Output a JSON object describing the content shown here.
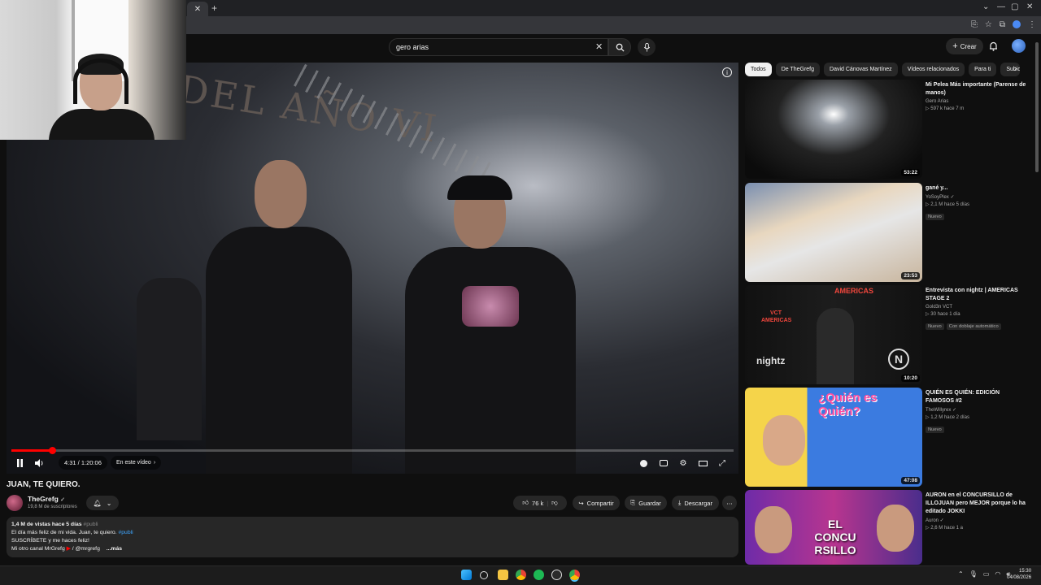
{
  "browser": {
    "tab_close": "✕",
    "new_tab": "+",
    "controls": [
      "⌄",
      "—",
      "▢",
      "✕"
    ]
  },
  "header": {
    "search_value": "gero arias",
    "create_label": "Crear"
  },
  "player": {
    "banner_text": "DEL AÑO VI",
    "current_time": "4:31",
    "duration": "1:20:06",
    "time_display": "4:31 / 1:20:06",
    "chapter_label": "En este vídeo",
    "progress": 0.0565
  },
  "video": {
    "title": "JUAN, TE QUIERO.",
    "channel": "TheGrefg",
    "subscribers": "19,8 M de suscriptores",
    "likes": "76 k",
    "share_label": "Compartir",
    "save_label": "Guardar",
    "download_label": "Descargar",
    "desc_views": "1,4 M de vistas  hace 5 días",
    "desc_tag": "#publi",
    "desc_line1": "El día más feliz de mi vida. Juan, te quiero. ",
    "desc_line2": "SUSCRÍBETE y me haces feliz!",
    "desc_line3_prefix": "Mi otro canal MrGrefg ",
    "desc_line3_handle": "/ @mrgrefg",
    "desc_more": "...más"
  },
  "chips": [
    "Todos",
    "De TheGrefg",
    "David Cánovas Martínez",
    "Vídeos relacionados",
    "Para ti",
    "Subid"
  ],
  "recommendations": [
    {
      "title": "Mi Pelea Más importante (Parense de manos)",
      "channel": "Gero Arias",
      "stats": "▷ 597 k  hace 7 m",
      "duration": "53:22",
      "badges": []
    },
    {
      "title": "gané y...",
      "channel": "YoSoyPlex ✓",
      "stats": "▷ 2,1 M  hace 5 días",
      "duration": "23:53",
      "badges": [
        "Nuevo"
      ]
    },
    {
      "title": "Entrevista con nightz | AMERICAS STAGE 2",
      "channel": "Gold3n VCT",
      "stats": "▷ 30  hace 1 día",
      "duration": "10:20",
      "badges": [
        "Nuevo",
        "Con doblaje automático"
      ],
      "thumb_text": "AMERICAS",
      "thumb_name": "nightz",
      "thumb_sub": "VCT AMERICAS"
    },
    {
      "title": "QUIÉN ES QUIÉN: EDICIÓN FAMOSOS #2",
      "channel": "TheWillyrex ✓",
      "stats": "▷ 1,2 M  hace 2 días",
      "duration": "47:08",
      "badges": [
        "Nuevo"
      ],
      "thumb_text": "¿Quién es Quién?"
    },
    {
      "title": "AURON en el CONCURSILLO de ILLOJUAN pero MEJOR porque lo ha editado JOKKI",
      "channel": "Auron ✓",
      "stats": "▷ 2,6 M  hace 1 a",
      "duration": "",
      "badges": [],
      "thumb_text": "EL CONCU RSILLO"
    }
  ],
  "clock": {
    "time": "15:30",
    "date": "04/08/2026"
  },
  "colors": {
    "accent": "#ff0000",
    "link": "#3ea6ff",
    "bg": "#0f0f0f",
    "surface": "#272727"
  }
}
